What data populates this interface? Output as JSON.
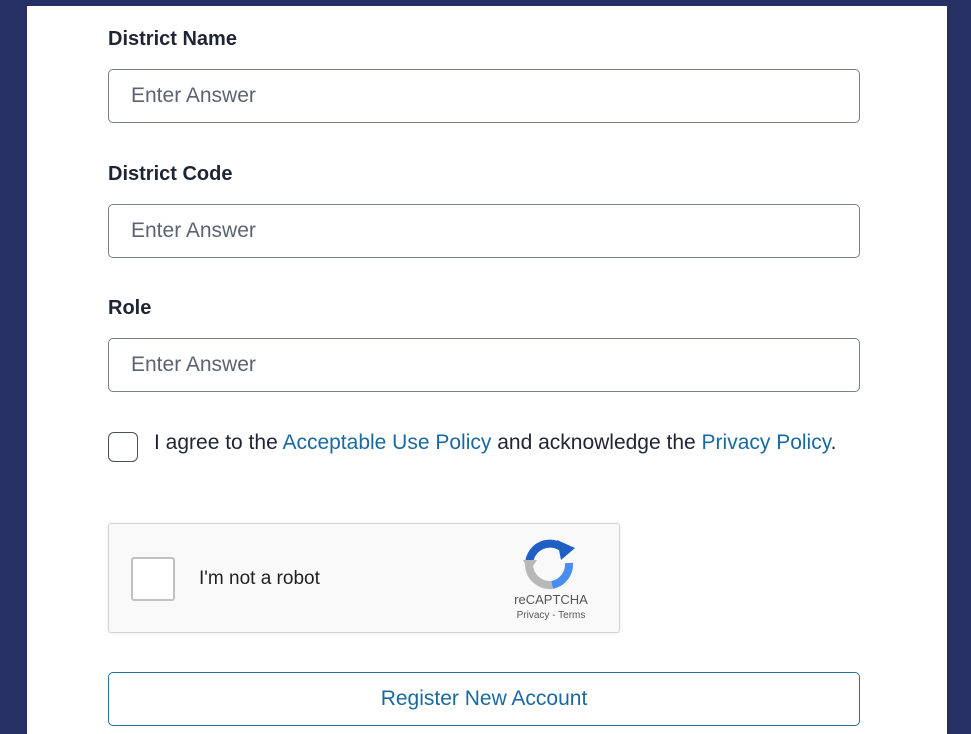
{
  "form": {
    "fields": [
      {
        "label": "District Name",
        "placeholder": "Enter Answer",
        "value": ""
      },
      {
        "label": "District Code",
        "placeholder": "Enter Answer",
        "value": ""
      },
      {
        "label": "Role",
        "placeholder": "Enter Answer",
        "value": ""
      }
    ],
    "agreement": {
      "checked": false,
      "text_before": "I agree to the ",
      "acceptable_use_link": "Acceptable Use Policy",
      "text_middle": " and acknowledge the ",
      "privacy_link": "Privacy Policy",
      "text_after": "."
    },
    "recaptcha": {
      "label": "I'm not a robot",
      "brand": "reCAPTCHA",
      "privacy": "Privacy",
      "separator": " - ",
      "terms": "Terms",
      "logo_icon": "recaptcha-logo-icon"
    },
    "submit_label": "Register New Account"
  },
  "colors": {
    "background": "#263064",
    "link": "#1a6aa0",
    "button_border": "#2a6f9b"
  }
}
